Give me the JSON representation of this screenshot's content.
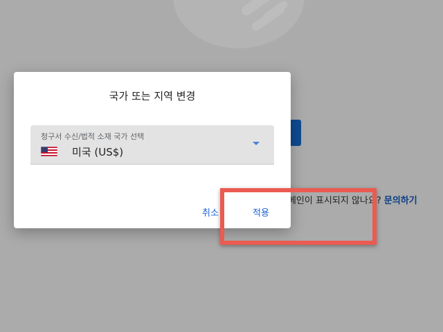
{
  "dialog": {
    "title": "국가 또는 지역 변경",
    "country_select": {
      "label": "청구서 수신/법적 소재 국가 선택",
      "value": "미국 (US$)",
      "flag_icon": "us-flag-icon",
      "dropdown_icon": "dropdown-arrow-icon"
    },
    "cancel_label": "취소",
    "apply_label": "적용"
  },
  "background": {
    "domain_help_text": "도메인이 표시되지 않나요?",
    "contact_link": "문의하기"
  },
  "colors": {
    "scrim": "#ababab",
    "dialog": "#ffffff",
    "accent": "#1a62d6",
    "highlight": "#ea5b51",
    "bg_button": "#0e4a91"
  }
}
